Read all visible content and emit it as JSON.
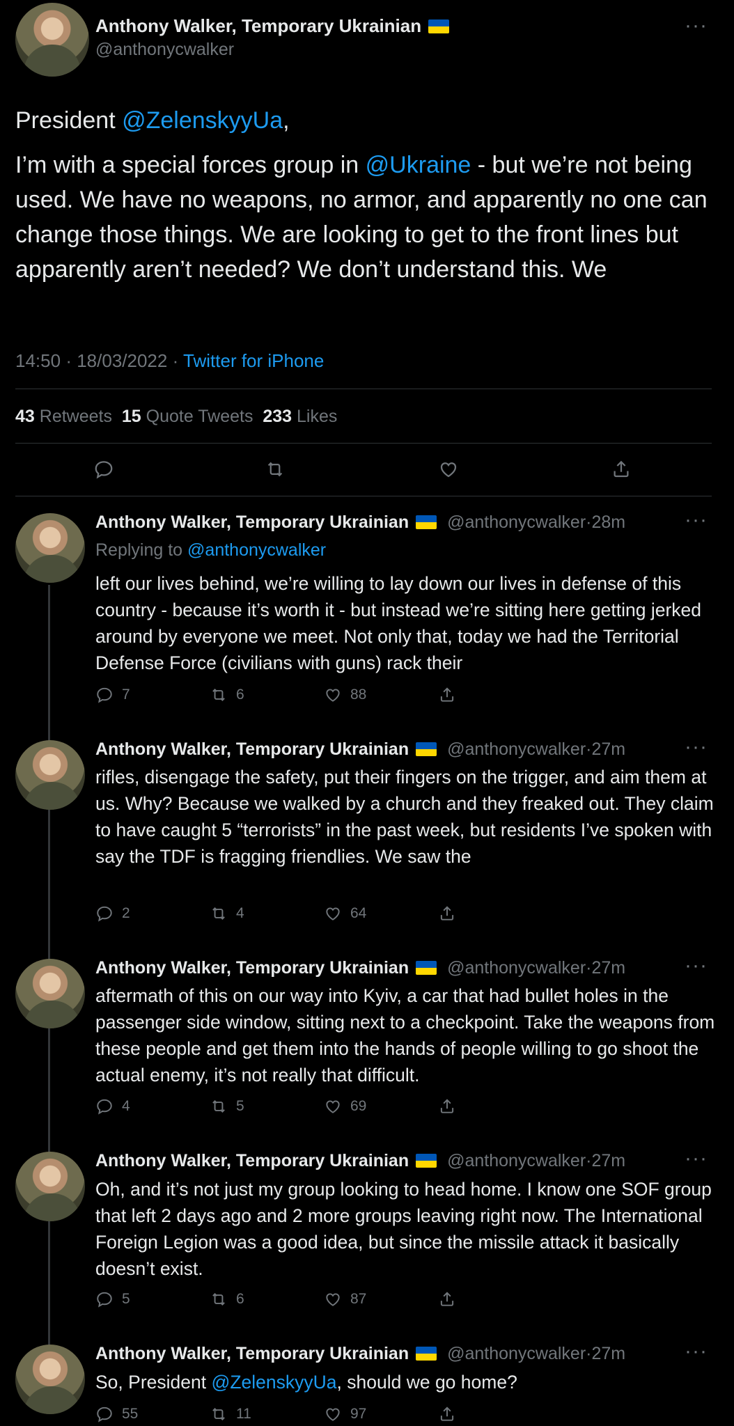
{
  "main": {
    "name": "Anthony Walker, Temporary Ukrainian",
    "handle": "@anthonycwalker",
    "text_part1": "President ",
    "mention1": "@ZelenskyyUa",
    "text_part2": ",",
    "text_part3": "I’m with a special forces group in ",
    "mention2": "@Ukraine",
    "text_part4": " - but we’re not being used. We have no weapons, no armor, and apparently no one can change those things. We are looking to get to the front lines but apparently aren’t needed? We don’t understand this. We",
    "time": "14:50",
    "date": "18/03/2022",
    "client": "Twitter for iPhone",
    "retweets_count": "43",
    "retweets_label": "Retweets",
    "quotes_count": "15",
    "quotes_label": "Quote Tweets",
    "likes_count": "233",
    "likes_label": "Likes"
  },
  "replies": [
    {
      "name": "Anthony Walker, Temporary Ukrainian",
      "handle": "@anthonycwalker",
      "time": "28m",
      "replying_prefix": "Replying to ",
      "replying_to": "@anthonycwalker",
      "text": "left our lives behind, we’re willing to lay down our lives in defense of this country - because it’s worth it -  but instead we’re sitting here getting jerked around by everyone we meet. Not only that, today we had the Territorial Defense Force (civilians with guns) rack their",
      "replies": "7",
      "retweets": "6",
      "likes": "88"
    },
    {
      "name": "Anthony Walker, Temporary Ukrainian",
      "handle": "@anthonycwalker",
      "time": "27m",
      "text": "rifles, disengage the safety, put their fingers on the trigger, and aim them at us. Why? Because we walked by a church and they freaked out. They claim to have caught 5 “terrorists” in the past week, but residents I’ve spoken with say the TDF is fragging friendlies. We saw the",
      "replies": "2",
      "retweets": "4",
      "likes": "64"
    },
    {
      "name": "Anthony Walker, Temporary Ukrainian",
      "handle": "@anthonycwalker",
      "time": "27m",
      "text": "aftermath of this on our way into Kyiv, a car that had bullet holes in the passenger side window, sitting next to a checkpoint. Take the weapons from these people and get them into the hands of people willing to go shoot the actual enemy, it’s not really that difficult.",
      "replies": "4",
      "retweets": "5",
      "likes": "69"
    },
    {
      "name": "Anthony Walker, Temporary Ukrainian",
      "handle": "@anthonycwalker",
      "time": "27m",
      "text": "Oh, and it’s not just my group looking to head home. I know one SOF group that left 2 days ago and 2 more groups leaving right now. The International Foreign Legion was a good idea, but since the missile attack it basically doesn’t exist.",
      "replies": "5",
      "retweets": "6",
      "likes": "87"
    },
    {
      "name": "Anthony Walker, Temporary Ukrainian",
      "handle": "@anthonycwalker",
      "time": "27m",
      "text_before": "So, President ",
      "mention": "@ZelenskyyUa",
      "text_after": ", should we go home?",
      "replies": "55",
      "retweets": "11",
      "likes": "97"
    }
  ],
  "icons": {
    "more": "more-icon",
    "flag": "ukraine-flag-icon",
    "reply": "reply-icon",
    "retweet": "retweet-icon",
    "like": "heart-icon",
    "share": "share-icon"
  },
  "ui": {
    "more_glyph": "···",
    "dot": "·"
  }
}
